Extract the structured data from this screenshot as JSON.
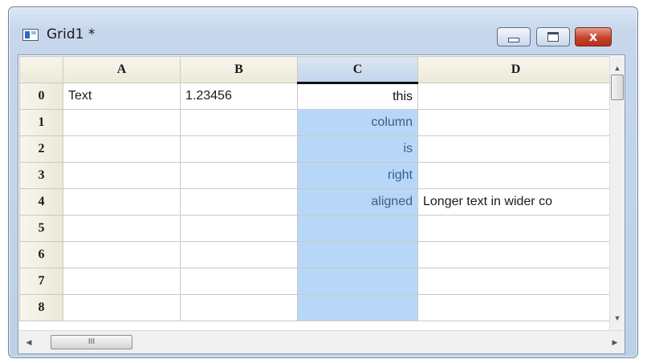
{
  "window": {
    "title": "Grid1 *",
    "icon": "grid-app-icon",
    "controls": {
      "minimize": "minimize-icon",
      "maximize": "maximize-icon",
      "close_glyph": "x"
    }
  },
  "grid": {
    "columns": [
      "A",
      "B",
      "C",
      "D"
    ],
    "selected_column": "C",
    "rows": [
      {
        "header": "0",
        "cells": [
          "Text",
          "1.23456",
          "this",
          ""
        ]
      },
      {
        "header": "1",
        "cells": [
          "",
          "",
          "column",
          ""
        ]
      },
      {
        "header": "2",
        "cells": [
          "",
          "",
          "is",
          ""
        ]
      },
      {
        "header": "3",
        "cells": [
          "",
          "",
          "right",
          ""
        ]
      },
      {
        "header": "4",
        "cells": [
          "",
          "",
          "aligned",
          "Longer text in wider co"
        ]
      },
      {
        "header": "5",
        "cells": [
          "",
          "",
          "",
          ""
        ]
      },
      {
        "header": "6",
        "cells": [
          "",
          "",
          "",
          ""
        ]
      },
      {
        "header": "7",
        "cells": [
          "",
          "",
          "",
          ""
        ]
      },
      {
        "header": "8",
        "cells": [
          "",
          "",
          "",
          ""
        ]
      }
    ]
  },
  "scrollbars": {
    "vertical": {
      "up": "▲",
      "down": "▼"
    },
    "horizontal": {
      "left": "◀",
      "right": "▶",
      "grip": "III"
    }
  },
  "colors": {
    "selection": "#b8d7f8",
    "header": "#ece9d8",
    "close_button": "#c6422c"
  }
}
